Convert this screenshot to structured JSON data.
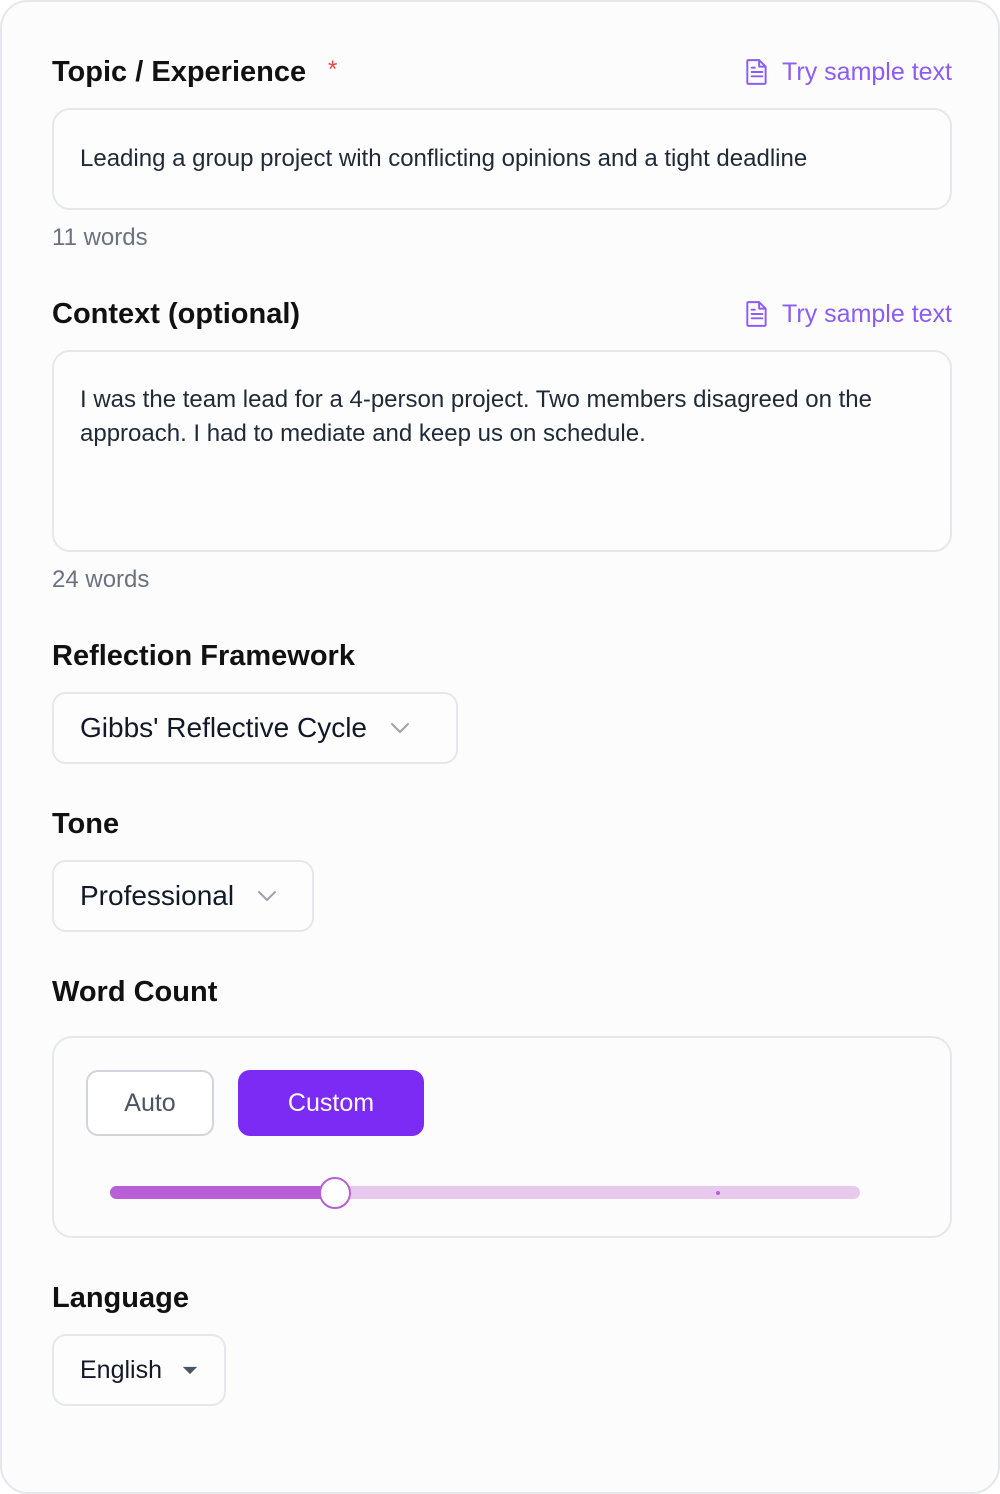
{
  "topic": {
    "label": "Topic / Experience",
    "required_mark": "*",
    "sample_link": "Try sample text",
    "value": "Leading a group project with conflicting opinions and a tight deadline",
    "word_count": "11 words"
  },
  "context": {
    "label": "Context (optional)",
    "sample_link": "Try sample text",
    "value": "I was the team lead for a 4-person project. Two members disagreed on the approach. I had to mediate and keep us on schedule.",
    "word_count": "24 words"
  },
  "framework": {
    "label": "Reflection Framework",
    "selected": "Gibbs' Reflective Cycle"
  },
  "tone": {
    "label": "Tone",
    "selected": "Professional"
  },
  "word_count_section": {
    "label": "Word Count",
    "auto_label": "Auto",
    "custom_label": "Custom",
    "active_mode": "Custom",
    "slider_fraction": 0.3,
    "slider_marker_fraction": 0.81
  },
  "language": {
    "label": "Language",
    "selected": "English"
  },
  "colors": {
    "accent": "#7c2bf5",
    "link": "#8b5cf6",
    "slider_fill": "#b65fd6",
    "slider_track": "#e7c9ee",
    "required": "#ef4444"
  },
  "icons": {
    "sample_link": "document-icon",
    "select": "chevron-down-icon",
    "language_select": "caret-down-icon"
  }
}
